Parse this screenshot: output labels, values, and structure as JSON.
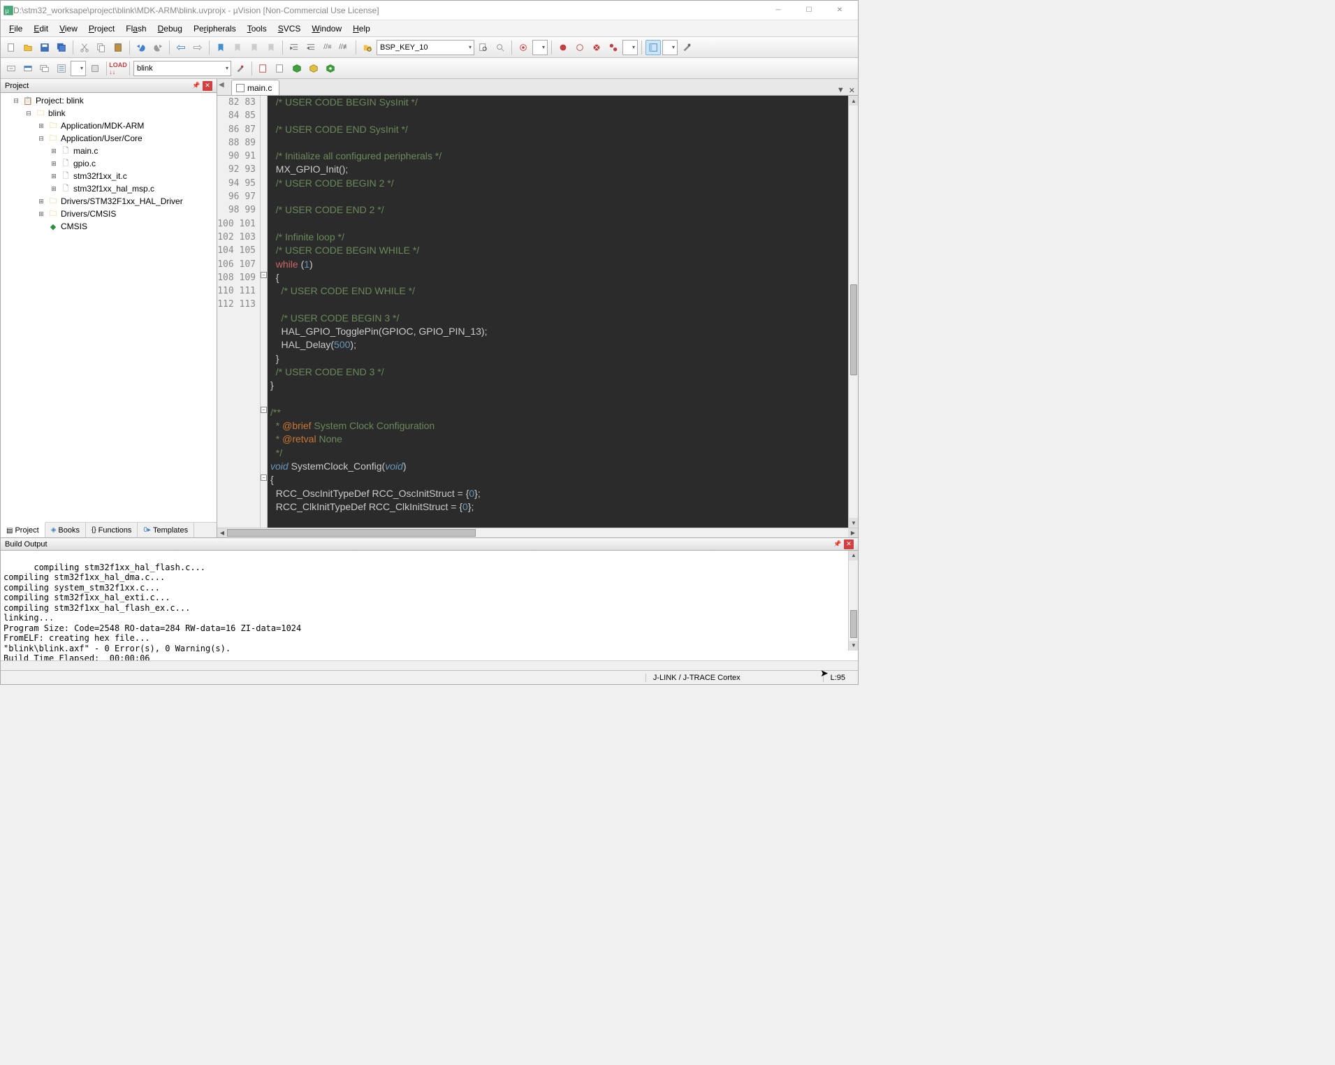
{
  "title": "D:\\stm32_worksape\\project\\blink\\MDK-ARM\\blink.uvprojx - µVision  [Non-Commercial Use License]",
  "menu": [
    "File",
    "Edit",
    "View",
    "Project",
    "Flash",
    "Debug",
    "Peripherals",
    "Tools",
    "SVCS",
    "Window",
    "Help"
  ],
  "toolbar": {
    "combo1": "BSP_KEY_10",
    "target": "blink"
  },
  "project_panel": {
    "title": "Project",
    "tabs": [
      "Project",
      "Books",
      "Functions",
      "Templates"
    ],
    "root": "Project: blink",
    "target": "blink",
    "groups": [
      {
        "name": "Application/MDK-ARM",
        "open": false
      },
      {
        "name": "Application/User/Core",
        "open": true,
        "files": [
          "main.c",
          "gpio.c",
          "stm32f1xx_it.c",
          "stm32f1xx_hal_msp.c"
        ]
      },
      {
        "name": "Drivers/STM32F1xx_HAL_Driver",
        "open": false
      },
      {
        "name": "Drivers/CMSIS",
        "open": false
      }
    ],
    "cmsis": "CMSIS"
  },
  "editor": {
    "tab": "main.c",
    "first_line": 82,
    "lines": [
      {
        "t": "comment",
        "txt": "  /* USER CODE BEGIN SysInit */"
      },
      {
        "t": "blank",
        "txt": ""
      },
      {
        "t": "comment",
        "txt": "  /* USER CODE END SysInit */"
      },
      {
        "t": "blank",
        "txt": ""
      },
      {
        "t": "comment",
        "txt": "  /* Initialize all configured peripherals */"
      },
      {
        "t": "code",
        "txt": "  MX_GPIO_Init();"
      },
      {
        "t": "comment",
        "txt": "  /* USER CODE BEGIN 2 */"
      },
      {
        "t": "blank",
        "txt": ""
      },
      {
        "t": "comment",
        "txt": "  /* USER CODE END 2 */"
      },
      {
        "t": "blank",
        "txt": ""
      },
      {
        "t": "comment",
        "txt": "  /* Infinite loop */"
      },
      {
        "t": "comment",
        "txt": "  /* USER CODE BEGIN WHILE */"
      },
      {
        "t": "while",
        "txt": "  while (1)"
      },
      {
        "t": "code",
        "txt": "  {"
      },
      {
        "t": "comment",
        "txt": "    /* USER CODE END WHILE */"
      },
      {
        "t": "blank",
        "txt": ""
      },
      {
        "t": "comment",
        "txt": "    /* USER CODE BEGIN 3 */"
      },
      {
        "t": "hal",
        "txt": "    HAL_GPIO_TogglePin(GPIOC, GPIO_PIN_13);"
      },
      {
        "t": "hal2",
        "txt": "    HAL_Delay(500);"
      },
      {
        "t": "code",
        "txt": "  }"
      },
      {
        "t": "comment",
        "txt": "  /* USER CODE END 3 */"
      },
      {
        "t": "code",
        "txt": "}"
      },
      {
        "t": "blank",
        "txt": ""
      },
      {
        "t": "doc",
        "txt": "/**"
      },
      {
        "t": "doc2",
        "txt": "  * @brief System Clock Configuration"
      },
      {
        "t": "doc3",
        "txt": "  * @retval None"
      },
      {
        "t": "doc",
        "txt": "  */"
      },
      {
        "t": "func",
        "txt": "void SystemClock_Config(void)"
      },
      {
        "t": "code",
        "txt": "{"
      },
      {
        "t": "rcc1",
        "txt": "  RCC_OscInitTypeDef RCC_OscInitStruct = {0};"
      },
      {
        "t": "rcc2",
        "txt": "  RCC_ClkInitTypeDef RCC_ClkInitStruct = {0};"
      },
      {
        "t": "blank",
        "txt": ""
      }
    ]
  },
  "build": {
    "title": "Build Output",
    "lines": [
      "compiling stm32f1xx_hal_flash.c...",
      "compiling stm32f1xx_hal_dma.c...",
      "compiling system_stm32f1xx.c...",
      "compiling stm32f1xx_hal_exti.c...",
      "compiling stm32f1xx_hal_flash_ex.c...",
      "linking...",
      "Program Size: Code=2548 RO-data=284 RW-data=16 ZI-data=1024",
      "FromELF: creating hex file...",
      "\"blink\\blink.axf\" - 0 Error(s), 0 Warning(s).",
      "Build Time Elapsed:  00:00:06"
    ]
  },
  "status": {
    "debugger": "J-LINK / J-TRACE Cortex",
    "pos": "L:95"
  }
}
